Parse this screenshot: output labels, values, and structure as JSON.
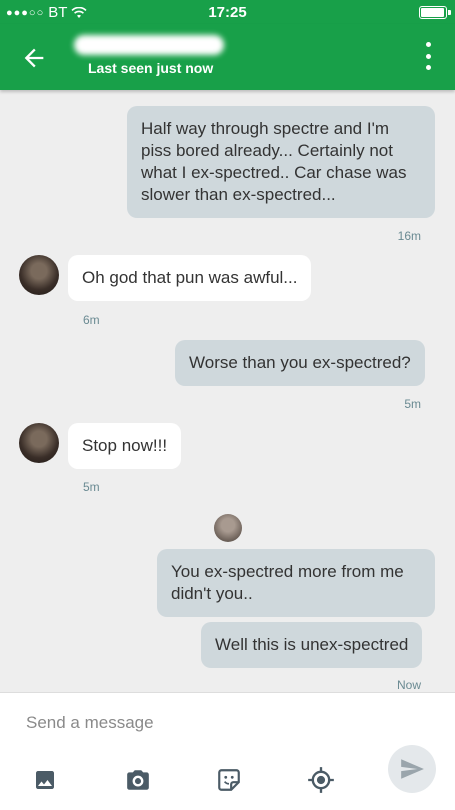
{
  "status_bar": {
    "carrier": "BT",
    "time": "17:25",
    "battery_level": 0.95
  },
  "app_bar": {
    "subtitle": "Last seen just now"
  },
  "messages": [
    {
      "direction": "out",
      "text": "Half way through spectre and I'm piss bored already... Certainly not what I ex-spectred.. Car chase was slower than ex-spectred...",
      "time": "16m"
    },
    {
      "direction": "in",
      "text": "Oh god that pun was awful...",
      "time": "6m"
    },
    {
      "direction": "out",
      "text": "Worse than you ex-spectred?",
      "time": "5m"
    },
    {
      "direction": "in",
      "text": "Stop now!!!",
      "time": "5m"
    },
    {
      "direction": "out",
      "text": "You ex-spectred more from me didn't you..",
      "time": ""
    },
    {
      "direction": "out",
      "text": "Well this is unex-spectred",
      "time": "Now"
    }
  ],
  "composer": {
    "placeholder": "Send a message",
    "tools": [
      "image-icon",
      "camera-icon",
      "sticker-icon",
      "location-icon"
    ],
    "send_icon": "send-icon"
  },
  "colors": {
    "primary": "#18a049",
    "outgoing_bubble": "#cfd8dc",
    "incoming_bubble": "#ffffff"
  }
}
